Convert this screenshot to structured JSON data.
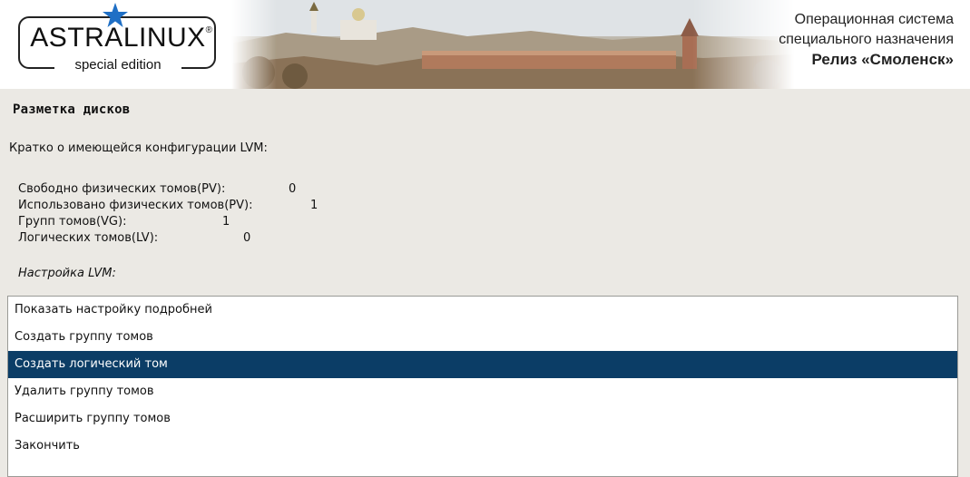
{
  "banner": {
    "logo_text": "ASTRALINUX",
    "logo_reg": "®",
    "logo_subtitle": "special edition",
    "os_line1": "Операционная система",
    "os_line2": "специального назначения",
    "release": "Релиз «Смоленск»",
    "accent_star": "#1f6fc5"
  },
  "heading": "Разметка дисков",
  "summary_intro": "Кратко о имеющейся конфигурации LVM:",
  "stats": [
    {
      "label": "Свободно физических томов(PV):",
      "value": "0"
    },
    {
      "label": "Использовано физических томов(PV):",
      "value": "1"
    },
    {
      "label": "Групп томов(VG):",
      "value": "1"
    },
    {
      "label": "Логических томов(LV):",
      "value": "0"
    }
  ],
  "lvm_label": "Настройка LVM:",
  "menu": [
    {
      "label": "Показать настройку подробней",
      "selected": false
    },
    {
      "label": "Создать группу томов",
      "selected": false
    },
    {
      "label": "Создать логический том",
      "selected": true
    },
    {
      "label": "Удалить группу томов",
      "selected": false
    },
    {
      "label": "Расширить группу томов",
      "selected": false
    },
    {
      "label": "Закончить",
      "selected": false
    }
  ],
  "colors": {
    "selection": "#0b3d66",
    "background": "#ebe9e4"
  }
}
